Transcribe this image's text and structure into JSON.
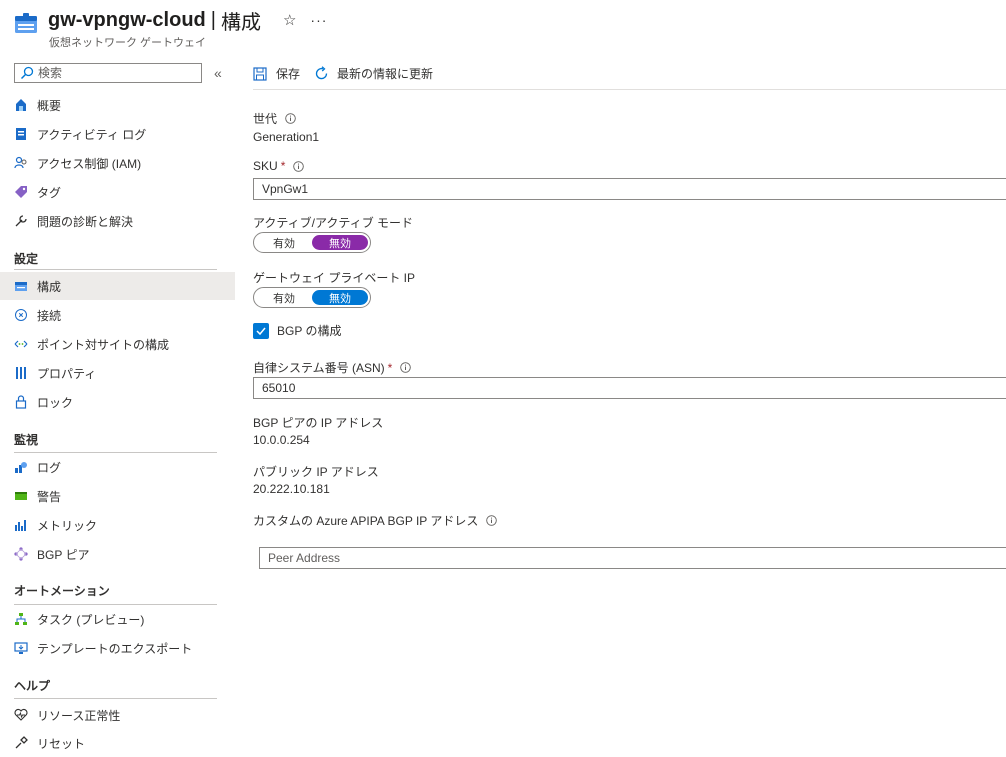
{
  "header": {
    "resource_name": "gw-vpngw-cloud",
    "separator": "|",
    "page_name": "構成",
    "subtitle": "仮想ネットワーク ゲートウェイ",
    "star": "☆",
    "more": "···"
  },
  "sidebar": {
    "search_placeholder": "検索",
    "collapse": "«",
    "items_top": [
      {
        "label": "概要",
        "icon": "overview-icon"
      },
      {
        "label": "アクティビティ ログ",
        "icon": "activity-log-icon"
      },
      {
        "label": "アクセス制御 (IAM)",
        "icon": "iam-icon"
      },
      {
        "label": "タグ",
        "icon": "tag-icon"
      },
      {
        "label": "問題の診断と解決",
        "icon": "wrench-icon"
      }
    ],
    "sections": [
      {
        "title": "設定",
        "items": [
          {
            "label": "構成",
            "icon": "configuration-icon",
            "selected": true
          },
          {
            "label": "接続",
            "icon": "connection-icon"
          },
          {
            "label": "ポイント対サイトの構成",
            "icon": "p2s-icon"
          },
          {
            "label": "プロパティ",
            "icon": "properties-icon"
          },
          {
            "label": "ロック",
            "icon": "lock-icon"
          }
        ]
      },
      {
        "title": "監視",
        "items": [
          {
            "label": "ログ",
            "icon": "logs-icon"
          },
          {
            "label": "警告",
            "icon": "alerts-icon"
          },
          {
            "label": "メトリック",
            "icon": "metrics-icon"
          },
          {
            "label": "BGP ピア",
            "icon": "bgp-peers-icon"
          }
        ]
      },
      {
        "title": "オートメーション",
        "items": [
          {
            "label": "タスク (プレビュー)",
            "icon": "tasks-icon"
          },
          {
            "label": "テンプレートのエクスポート",
            "icon": "export-template-icon"
          }
        ]
      },
      {
        "title": "ヘルプ",
        "items": [
          {
            "label": "リソース正常性",
            "icon": "resource-health-icon"
          },
          {
            "label": "リセット",
            "icon": "reset-icon"
          }
        ]
      }
    ]
  },
  "toolbar": {
    "save_label": "保存",
    "refresh_label": "最新の情報に更新"
  },
  "form": {
    "generation_label": "世代",
    "generation_value": "Generation1",
    "sku_label": "SKU",
    "sku_required": "*",
    "sku_value": "VpnGw1",
    "active_active_label": "アクティブ/アクティブ モード",
    "active_active_options": [
      "有効",
      "無効"
    ],
    "active_active_selected": "無効",
    "private_ip_label": "ゲートウェイ プライベート IP",
    "private_ip_options": [
      "有効",
      "無効"
    ],
    "private_ip_selected": "無効",
    "bgp_checkbox_label": "BGP の構成",
    "bgp_checked": true,
    "asn_label": "自律システム番号 (ASN)",
    "asn_required": "*",
    "asn_value": "65010",
    "bgp_peer_ip_label": "BGP ピアの IP アドレス",
    "bgp_peer_ip_value": "10.0.0.254",
    "public_ip_label": "パブリック IP アドレス",
    "public_ip_value": "20.222.10.181",
    "apipa_label": "カスタムの Azure APIPA BGP IP アドレス",
    "apipa_placeholder": "Peer Address"
  },
  "colors": {
    "accent": "#0078d4",
    "toggle_purple": "#8a2aa8",
    "required": "#a4262c",
    "selected_bg": "#edebe9"
  }
}
